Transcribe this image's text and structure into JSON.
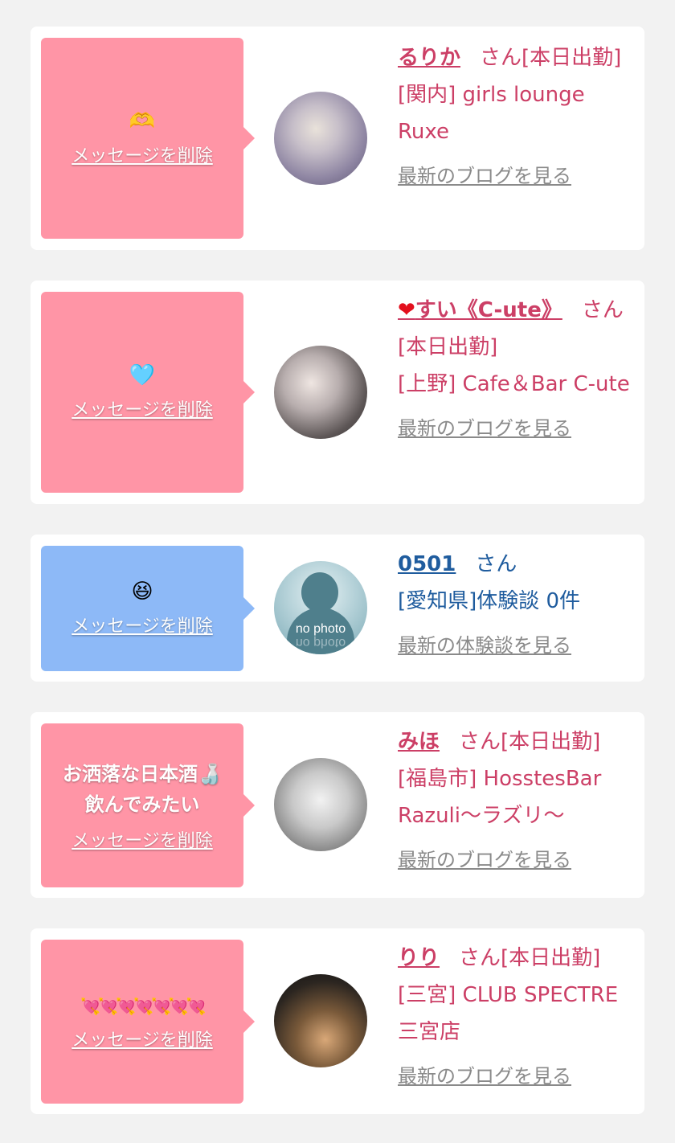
{
  "cards": [
    {
      "emoji": "🫶",
      "delete_label": "メッセージを削除",
      "name": "るりか",
      "san": "さん[本日出勤]",
      "shop": "[関内] girls lounge Ruxe",
      "blog": "最新のブログを見る"
    },
    {
      "emoji": "🩵",
      "delete_label": "メッセージを削除",
      "name_prefix": "❤",
      "name": "すい《C-ute》",
      "san": "さん",
      "status": "[本日出勤]",
      "shop": "[上野] Cafe＆Bar C-ute",
      "blog": "最新のブログを見る"
    },
    {
      "emoji": "😆",
      "delete_label": "メッセージを削除",
      "name": "0501",
      "san": "さん",
      "shop": "[愛知県]体験談 0件",
      "blog": "最新の体験談を見る",
      "avatar_text": "no photo"
    },
    {
      "message": "お洒落な日本酒🍶\n飲んでみたい",
      "delete_label": "メッセージを削除",
      "name": "みほ",
      "san": "さん[本日出勤]",
      "shop": "[福島市] HosstesBar Razuli〜ラズリ〜",
      "blog": "最新のブログを見る"
    },
    {
      "emoji_row": "💘💘💘💘💘💘💘",
      "delete_label": "メッセージを削除",
      "name": "りり",
      "san": "さん[本日出勤]",
      "shop": "[三宮] CLUB SPECTRE 三宮店",
      "blog": "最新のブログを見る"
    }
  ],
  "colors": {
    "bubble_pink": "#ff95a6",
    "bubble_blue": "#8db9f7",
    "cast_text": "#cc3f66",
    "user_text": "#1f5c9e",
    "link_gray": "#8a8a8a"
  }
}
